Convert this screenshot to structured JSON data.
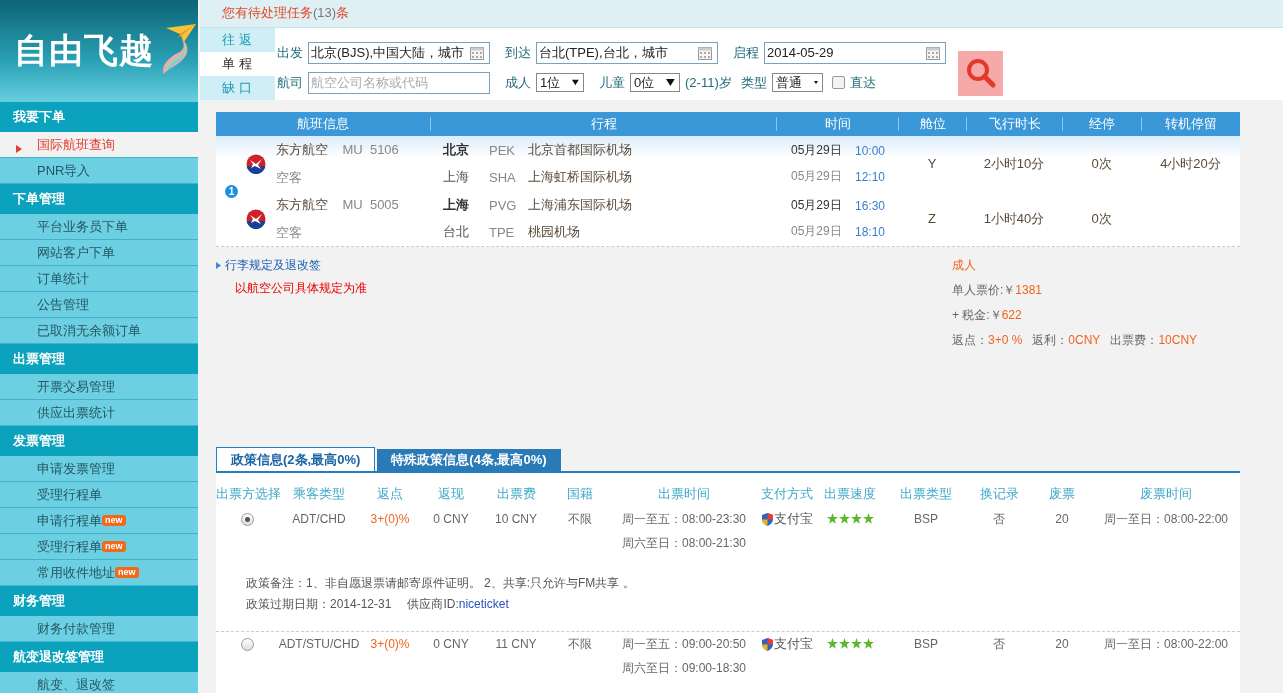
{
  "logo": {
    "text": "自由飞越"
  },
  "sidebar": [
    {
      "title": "我要下单",
      "items": [
        {
          "label": "国际航班查询",
          "selected": true
        },
        {
          "label": "PNR导入",
          "selected": false
        }
      ]
    },
    {
      "title": "下单管理",
      "items": [
        {
          "label": "平台业务员下单",
          "selected": false
        },
        {
          "label": "网站客户下单",
          "selected": false
        },
        {
          "label": "订单统计",
          "selected": false
        },
        {
          "label": "公告管理",
          "selected": false
        },
        {
          "label": "已取消无余额订单",
          "selected": false
        }
      ]
    },
    {
      "title": "出票管理",
      "items": [
        {
          "label": "开票交易管理",
          "selected": false
        },
        {
          "label": "供应出票统计",
          "selected": false
        }
      ]
    },
    {
      "title": "发票管理",
      "items": [
        {
          "label": "申请发票管理",
          "selected": false
        },
        {
          "label": "受理行程单",
          "selected": false
        },
        {
          "label": "申请行程单",
          "selected": false,
          "badge": "new"
        },
        {
          "label": "受理行程单",
          "selected": false,
          "badge": "new"
        },
        {
          "label": "常用收件地址",
          "selected": false,
          "badge": "new"
        }
      ]
    },
    {
      "title": "财务管理",
      "items": [
        {
          "label": "财务付款管理",
          "selected": false
        }
      ]
    },
    {
      "title": "航变退改签管理",
      "items": [
        {
          "label": "航变、退改签",
          "selected": false
        }
      ]
    }
  ],
  "notice": {
    "text": "您有待处理任务",
    "count": "(13)",
    "suffix": "条"
  },
  "trip_tabs": [
    {
      "label": "往 返",
      "selected": false
    },
    {
      "label": "单 程",
      "selected": true
    },
    {
      "label": "缺 口",
      "selected": false
    }
  ],
  "search": {
    "from_label": "出发",
    "from": "北京(BJS),中国大陆，城市",
    "to_label": "到达",
    "to": "台北(TPE),台北，城市",
    "date_label": "启程",
    "date": "2014-05-29",
    "airline_label": "航司",
    "airline_placeholder": "航空公司名称或代码",
    "adult_label": "成人",
    "adult": "1位",
    "child_label": "儿童",
    "child": "0位",
    "child_note": "(2-11)岁",
    "type_label": "类型",
    "type": "普通",
    "direct_label": "直达",
    "direct_checked": false
  },
  "flight_table": {
    "columns": [
      "航班信息",
      "行程",
      "时间",
      "舱位",
      "飞行时长",
      "经停",
      "转机停留"
    ],
    "index": "1",
    "segments": [
      {
        "airline": "东方航空",
        "carrier": "MU",
        "number": "5106",
        "aircraft": "空客",
        "dep": {
          "city": "北京",
          "code": "PEK",
          "airport": "北京首都国际机场",
          "date": "05月29日",
          "time": "10:00"
        },
        "arr": {
          "city": "上海",
          "code": "SHA",
          "airport": "上海虹桥国际机场",
          "date": "05月29日",
          "time": "12:10"
        },
        "cabin": "Y",
        "duration": "2小时10分",
        "stops": "0次",
        "transfer": "4小时20分"
      },
      {
        "airline": "东方航空",
        "carrier": "MU",
        "number": "5005",
        "aircraft": "空客",
        "dep": {
          "city": "上海",
          "code": "PVG",
          "airport": "上海浦东国际机场",
          "date": "05月29日",
          "time": "16:30"
        },
        "arr": {
          "city": "台北",
          "code": "TPE",
          "airport": "桃园机场",
          "date": "05月29日",
          "time": "18:10"
        },
        "cabin": "Z",
        "duration": "1小时40分",
        "stops": "0次"
      }
    ]
  },
  "rules": {
    "link": "行李规定及退改签",
    "note": "以航空公司具体规定为准"
  },
  "price": {
    "passenger": "成人",
    "fare_label": "单人票价:￥",
    "fare": "1381",
    "tax_label": "+ 税金:￥",
    "tax": "622",
    "rebate_label": "返点：",
    "rebate": "3+0 %",
    "cashback_label": "返利：",
    "cashback": "0CNY",
    "fee_label": "出票费：",
    "fee": "10CNY"
  },
  "policy_tabs": [
    {
      "label": "政策信息(2条,最高0%)",
      "selected": true
    },
    {
      "label": "特殊政策信息(4条,最高0%)",
      "selected": false
    }
  ],
  "policy_table": {
    "columns": [
      "出票方选择",
      "乘客类型",
      "返点",
      "返现",
      "出票费",
      "国籍",
      "出票时间",
      "支付方式",
      "出票速度",
      "出票类型",
      "换记录",
      "废票",
      "废票时间"
    ],
    "rows": [
      {
        "selected": true,
        "passenger": "ADT/CHD",
        "rebate": "3+(0)%",
        "cash": "0 CNY",
        "fee": "10 CNY",
        "nationality": "不限",
        "ticket_times": [
          "周一至五：08:00-23:30",
          "周六至日：08:00-21:30"
        ],
        "payment": "支付宝",
        "stars": 4,
        "ticket_type": "BSP",
        "rebook": "否",
        "void": "20",
        "void_time": "周一至日：08:00-22:00",
        "remark": "政策备注：1、非自愿退票请邮寄原件证明。 2、共享:只允许与FM共享 。",
        "expiry": "政策过期日期：2014-12-31",
        "supplier_label": "供应商ID:",
        "supplier": "niceticket"
      },
      {
        "selected": false,
        "passenger": "ADT/STU/CHD",
        "rebate": "3+(0)%",
        "cash": "0 CNY",
        "fee": "11 CNY",
        "nationality": "不限",
        "ticket_times": [
          "周一至五：09:00-20:50",
          "周六至日：09:00-18:30"
        ],
        "payment": "支付宝",
        "stars": 4,
        "ticket_type": "BSP",
        "rebook": "否",
        "void": "20",
        "void_time": "周一至日：08:00-22:00"
      }
    ]
  }
}
